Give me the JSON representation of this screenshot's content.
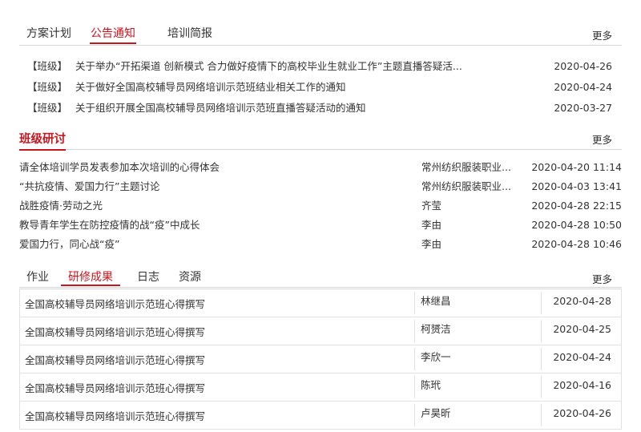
{
  "notice_section": {
    "tabs": [
      "方案计划",
      "公告通知",
      "培训简报"
    ],
    "more": "更多",
    "items": [
      {
        "tag": "【班级】",
        "title": "关于举办“开拓渠道 创新模式 合力做好疫情下的高校毕业生就业工作”主题直播答疑活...",
        "date": "2020-04-26"
      },
      {
        "tag": "【班级】",
        "title": "关于做好全国高校辅导员网络培训示范班结业相关工作的通知",
        "date": "2020-04-24"
      },
      {
        "tag": "【班级】",
        "title": "关于组织开展全国高校辅导员网络培训示范班直播答疑活动的通知",
        "date": "2020-03-27"
      }
    ]
  },
  "discussion_section": {
    "title": "班级研讨",
    "more": "更多",
    "items": [
      {
        "title": "请全体培训学员发表参加本次培训的心得体会",
        "author": "常州纺织服装职业...",
        "date": "2020-04-20 11:14"
      },
      {
        "title": "“共抗疫情、爱国力行”主题讨论",
        "author": "常州纺织服装职业...",
        "date": "2020-04-03 13:41"
      },
      {
        "title": "战胜疫情·劳动之光",
        "author": "齐莹",
        "date": "2020-04-28 22:15"
      },
      {
        "title": "教导青年学生在防控疫情的战“疫”中成长",
        "author": "李由",
        "date": "2020-04-28 10:50"
      },
      {
        "title": "爱国力行，同心战“疫”",
        "author": "李由",
        "date": "2020-04-28 10:46"
      }
    ]
  },
  "results_section": {
    "tabs": [
      "作业",
      "研修成果",
      "日志",
      "资源"
    ],
    "more": "更多",
    "rows": [
      {
        "title": "全国高校辅导员网络培训示范班心得撰写",
        "author": "林继昌",
        "date": "2020-04-28"
      },
      {
        "title": "全国高校辅导员网络培训示范班心得撰写",
        "author": "柯赟洁",
        "date": "2020-04-25"
      },
      {
        "title": "全国高校辅导员网络培训示范班心得撰写",
        "author": "李欣一",
        "date": "2020-04-24"
      },
      {
        "title": "全国高校辅导员网络培训示范班心得撰写",
        "author": "陈玳",
        "date": "2020-04-16"
      },
      {
        "title": "全国高校辅导员网络培训示范班心得撰写",
        "author": "卢昊昕",
        "date": "2020-04-26"
      }
    ]
  },
  "colors": {
    "accent": "#c8161d",
    "text": "#333333",
    "border": "#d6d6d6"
  }
}
